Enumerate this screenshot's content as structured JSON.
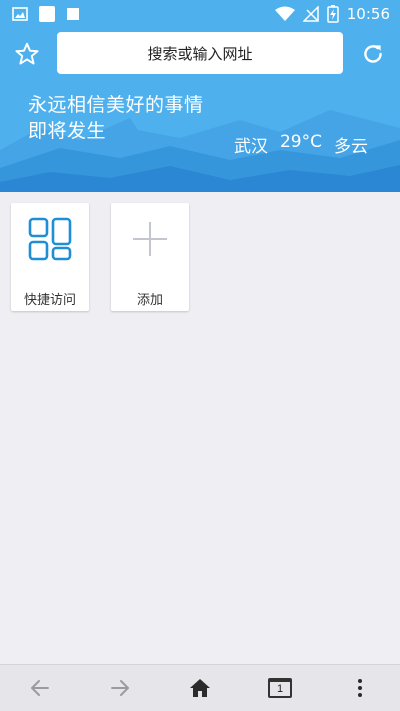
{
  "status_bar": {
    "time": "10:56",
    "left_icons": [
      "image-notification-icon",
      "square-notification-icon",
      "square-notification-icon"
    ],
    "right_icons": [
      "wifi-icon",
      "no-signal-icon",
      "battery-charging-icon"
    ]
  },
  "toolbar": {
    "address_placeholder": "搜索或输入网址",
    "star_icon": "star-outline-icon",
    "refresh_icon": "refresh-icon"
  },
  "header": {
    "slogan_line1": "永远相信美好的事情",
    "slogan_line2": "即将发生",
    "weather_city": "武汉",
    "weather_temp": "29°C",
    "weather_condition": "多云"
  },
  "tiles": [
    {
      "label": "快捷访问",
      "icon": "grid-apps-icon"
    },
    {
      "label": "添加",
      "icon": "plus-icon"
    }
  ],
  "bottom_nav": {
    "back_icon": "arrow-left-icon",
    "forward_icon": "arrow-right-icon",
    "home_icon": "home-icon",
    "tab_count": "1",
    "menu_icon": "more-vertical-icon"
  },
  "colors": {
    "header_sky": "#4fb0ee",
    "mountain_light": "#3d9ae0",
    "mountain_dark": "#2b86d4",
    "accent_blue": "#1e8fd6",
    "page_bg": "#eeeef3"
  }
}
